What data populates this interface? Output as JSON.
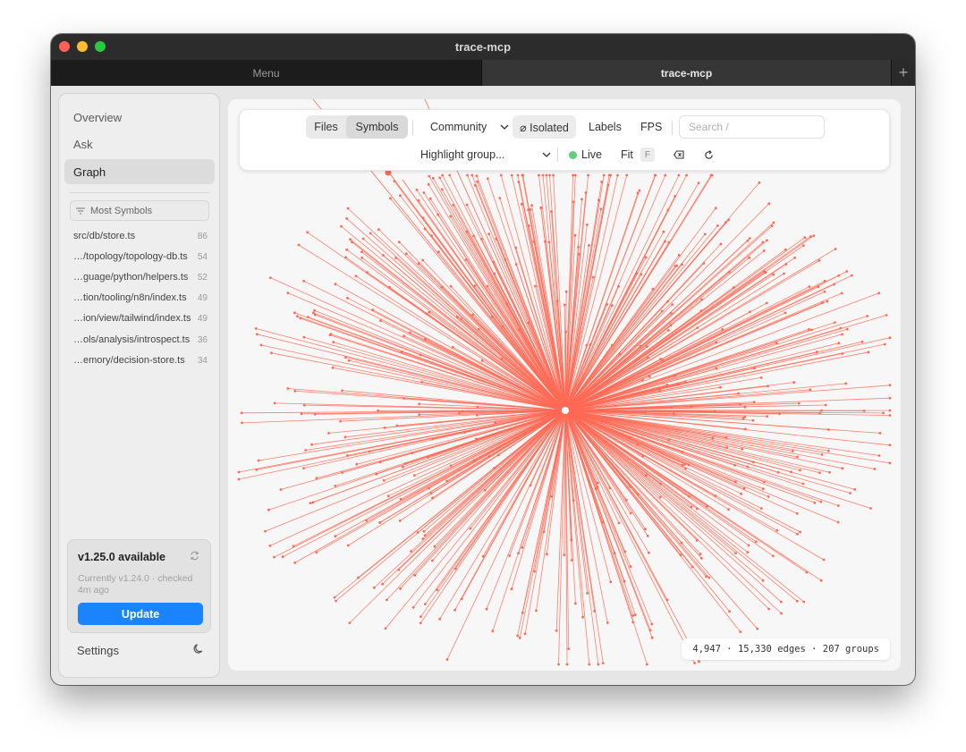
{
  "window": {
    "title": "trace-mcp"
  },
  "tabs": {
    "menu": "Menu",
    "active": "trace-mcp",
    "add": "+"
  },
  "sidebar": {
    "nav": [
      {
        "label": "Overview",
        "active": false
      },
      {
        "label": "Ask",
        "active": false
      },
      {
        "label": "Graph",
        "active": true
      }
    ],
    "sort_label": "Most Symbols",
    "files": [
      {
        "name": "src/db/store.ts",
        "count": "86"
      },
      {
        "name": "…/topology/topology-db.ts",
        "count": "54"
      },
      {
        "name": "…guage/python/helpers.ts",
        "count": "52"
      },
      {
        "name": "…tion/tooling/n8n/index.ts",
        "count": "49"
      },
      {
        "name": "…ion/view/tailwind/index.ts",
        "count": "49"
      },
      {
        "name": "…ols/analysis/introspect.ts",
        "count": "36"
      },
      {
        "name": "…emory/decision-store.ts",
        "count": "34"
      }
    ],
    "update": {
      "title": "v1.25.0 available",
      "subtitle": "Currently v1.24.0 · checked 4m ago",
      "button": "Update"
    },
    "settings": "Settings"
  },
  "toolbar": {
    "files": "Files",
    "symbols": "Symbols",
    "community": "Community",
    "isolated": "⌀ Isolated",
    "labels": "Labels",
    "fps": "FPS",
    "search_placeholder": "Search  /",
    "highlight": "Highlight group...",
    "live": "Live",
    "fit": "Fit",
    "fit_key": "F"
  },
  "stats": "4,947 · 15,330 edges · 207 groups",
  "colors": {
    "edge": "#ff6a55",
    "accent": "#1a84ff",
    "live": "#5fd07a"
  },
  "icons": [
    "filter-icon",
    "chevron-down-icon",
    "backspace-icon",
    "refresh-icon",
    "sync-icon",
    "moon-icon"
  ]
}
